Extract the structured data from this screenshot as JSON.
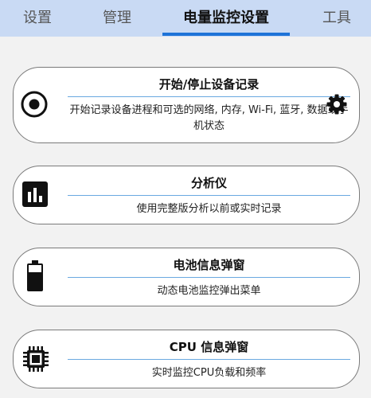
{
  "tabs": [
    {
      "label": "设置"
    },
    {
      "label": "管理"
    },
    {
      "label": "电量监控设置"
    },
    {
      "label": "工具"
    }
  ],
  "cards": [
    {
      "title": "开始/停止设备记录",
      "description": "开始记录设备进程和可选的网络, 内存, Wi-Fi, 蓝牙, 数据或手机状态",
      "icon": "record-icon",
      "trailing_icon": "gear-icon"
    },
    {
      "title": "分析仪",
      "description": "使用完整版分析以前或实时记录",
      "icon": "bar-chart-icon"
    },
    {
      "title": "电池信息弹窗",
      "description": "动态电池监控弹出菜单",
      "icon": "battery-icon"
    },
    {
      "title": "CPU 信息弹窗",
      "description": "实时监控CPU负载和频率",
      "icon": "cpu-icon"
    }
  ],
  "colors": {
    "tab_bar": "#c9daf4",
    "tab_indicator": "#1e73d8",
    "divider": "#6aa9e0",
    "background": "#f2f2f2"
  }
}
